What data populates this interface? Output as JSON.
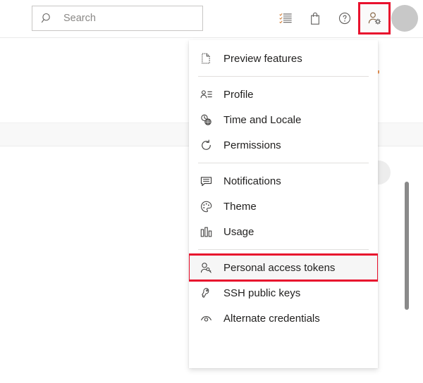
{
  "topbar": {
    "search": {
      "placeholder": "Search",
      "value": "",
      "icon": "search-icon"
    },
    "icons": [
      {
        "name": "boards-checklist-icon",
        "title": "Boards"
      },
      {
        "name": "marketplace-bag-icon",
        "title": "Marketplace"
      },
      {
        "name": "help-question-icon",
        "title": "Help"
      },
      {
        "name": "user-settings-icon",
        "title": "User settings",
        "highlighted": true
      }
    ],
    "avatar": {
      "name": "user-avatar",
      "title": "Account manager"
    }
  },
  "flyout": {
    "groups": [
      {
        "items": [
          {
            "label": "Preview features",
            "icon": "preview-page-icon"
          }
        ]
      },
      {
        "items": [
          {
            "label": "Profile",
            "icon": "profile-contact-card-icon"
          },
          {
            "label": "Time and Locale",
            "icon": "clock-globe-icon"
          },
          {
            "label": "Permissions",
            "icon": "refresh-permissions-icon"
          }
        ]
      },
      {
        "items": [
          {
            "label": "Notifications",
            "icon": "notifications-comment-icon"
          },
          {
            "label": "Theme",
            "icon": "theme-palette-icon"
          },
          {
            "label": "Usage",
            "icon": "usage-bar-chart-icon"
          }
        ]
      },
      {
        "items": [
          {
            "label": "Personal access tokens",
            "icon": "personal-access-token-key-icon",
            "highlighted": true
          },
          {
            "label": "SSH public keys",
            "icon": "ssh-key-icon"
          },
          {
            "label": "Alternate credentials",
            "icon": "alternate-credentials-icon"
          }
        ]
      }
    ]
  },
  "annotations": {
    "color": "#e8112d",
    "targets": [
      "user-settings-icon",
      "Personal access tokens"
    ]
  }
}
